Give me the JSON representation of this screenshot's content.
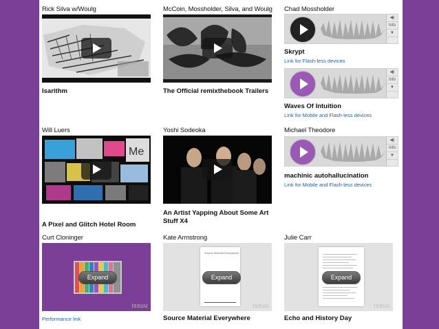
{
  "colors": {
    "background": "#7b3f98",
    "link": "#1f5fa8",
    "issuu_purple": "#7b3f98",
    "play_purple": "#9b59b6"
  },
  "row1": [
    {
      "author": "Rick Silva w/Woulg",
      "title": "Isarithm",
      "media": "video"
    },
    {
      "author": "McCoin, Mossholder, Silva, and Woulg",
      "title": "The Official remixthebook Trailers",
      "media": "video"
    },
    {
      "author": "Chad Mossholder",
      "tracks": [
        {
          "title": "Skrypt",
          "link": "Link for Flash-less devices"
        },
        {
          "title": "Waves Of Intuition",
          "link": "Link for Mobile and Flash-less devices"
        }
      ]
    }
  ],
  "row2": [
    {
      "author": "Will Luers",
      "title": "A Pixel and Glitch Hotel Room",
      "media": "video"
    },
    {
      "author": "Yoshi Sodeoka",
      "title": "An Artist Yapping About Some Art Stuff X4",
      "media": "video"
    },
    {
      "author": "Michael Theodore",
      "tracks": [
        {
          "title": "machinic autohallucination",
          "link": "Link for Mobile and Flash-less devices"
        }
      ]
    }
  ],
  "row3": [
    {
      "author": "Curt Cloninger",
      "expand": "Expand",
      "logo": "issuu",
      "link": "Performance link"
    },
    {
      "author": "Kate Armstrong",
      "expand": "Expand",
      "logo": "issuu",
      "title": "Source Material Everywhere",
      "doc_title": "Source Material Everywhere"
    },
    {
      "author": "Julie Carr",
      "expand": "Expand",
      "logo": "issuu",
      "title": "Echo and History Day"
    }
  ],
  "audio_controls": {
    "volume": "◀)",
    "info": "Info",
    "download": "▼"
  }
}
